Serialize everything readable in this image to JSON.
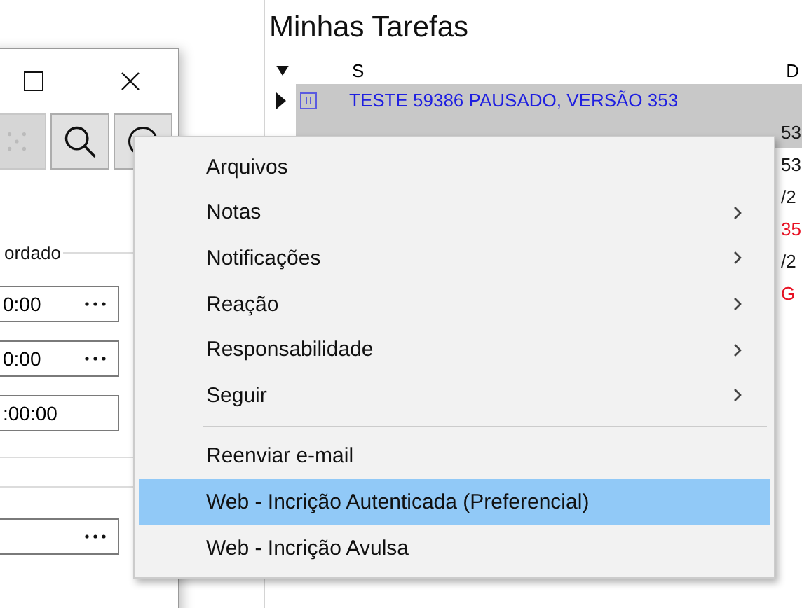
{
  "tasks_panel": {
    "title": "Minhas Tarefas",
    "columns": [
      "S",
      "D"
    ],
    "rows": [
      {
        "text": "TESTE 59386 PAUSADO, VERSÃO 353",
        "color": "#1f1fe0",
        "selected": true,
        "current": true
      },
      {
        "text": "53",
        "color": "#1a1a1a",
        "selected": true,
        "current": false
      },
      {
        "text": "53",
        "color": "#1a1a1a",
        "selected": false,
        "current": false
      },
      {
        "text": "/2",
        "color": "#1a1a1a",
        "selected": false,
        "current": false
      },
      {
        "text": "35",
        "color": "#e81123",
        "selected": false,
        "current": false
      },
      {
        "text": "/2",
        "color": "#1a1a1a",
        "selected": false,
        "current": false
      },
      {
        "text": "G",
        "color": "#e81123",
        "selected": false,
        "current": false
      }
    ]
  },
  "dialog": {
    "group_label": "ordado",
    "fields": [
      {
        "value": "0:00",
        "kind": "browse"
      },
      {
        "value": "0:00",
        "kind": "browse"
      },
      {
        "value": ":00:00",
        "kind": "plain"
      }
    ],
    "lower_field": {
      "kind": "browse"
    }
  },
  "context_menu": {
    "items": [
      {
        "kind": "item",
        "label": "Arquivos",
        "submenu": false,
        "selected": false
      },
      {
        "kind": "item",
        "label": "Notas",
        "submenu": true,
        "selected": false
      },
      {
        "kind": "item",
        "label": "Notificações",
        "submenu": true,
        "selected": false
      },
      {
        "kind": "item",
        "label": "Reação",
        "submenu": true,
        "selected": false
      },
      {
        "kind": "item",
        "label": "Responsabilidade",
        "submenu": true,
        "selected": false
      },
      {
        "kind": "item",
        "label": "Seguir",
        "submenu": true,
        "selected": false
      },
      {
        "kind": "separator"
      },
      {
        "kind": "item",
        "label": "Reenviar e-mail",
        "submenu": false,
        "selected": false
      },
      {
        "kind": "item",
        "label": "Web - Incrição Autenticada (Preferencial)",
        "submenu": false,
        "selected": true
      },
      {
        "kind": "item",
        "label": "Web - Incrição Avulsa",
        "submenu": false,
        "selected": false
      }
    ]
  }
}
